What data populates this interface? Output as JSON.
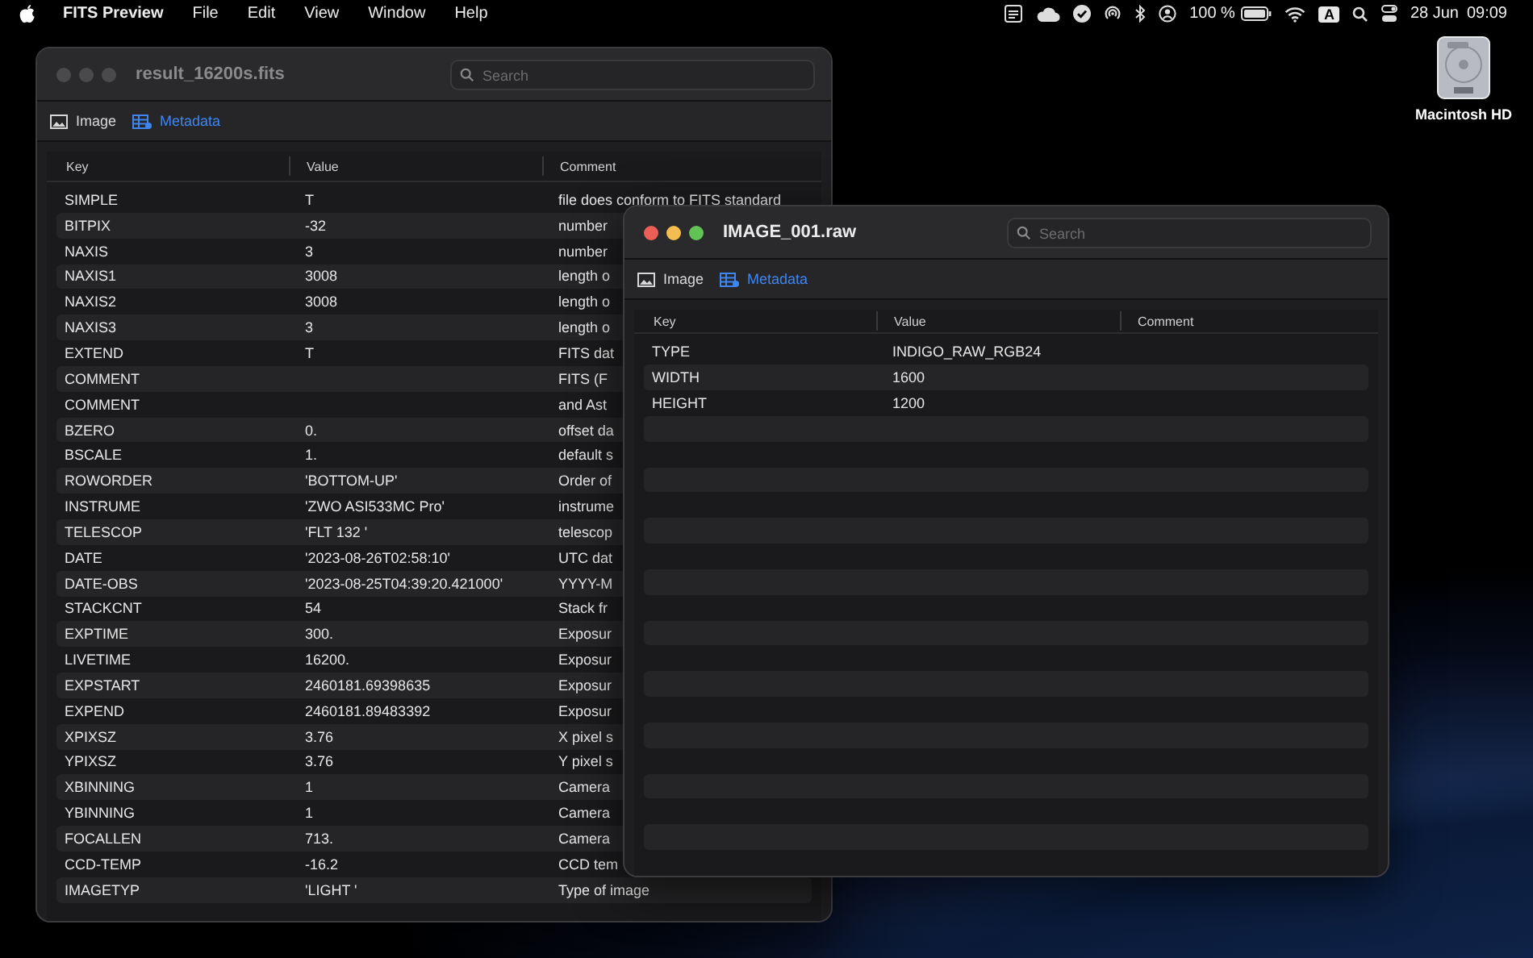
{
  "menu_bar": {
    "app": "FITS Preview",
    "menus": [
      "File",
      "Edit",
      "View",
      "Window",
      "Help"
    ],
    "battery_text": "100 %",
    "input_source": "A",
    "date": "28 Jun",
    "time": "09:09"
  },
  "desktop_icons": [
    {
      "label": "Macintosh HD"
    }
  ],
  "windows": [
    {
      "title": "result_16200s.fits",
      "active": false,
      "search": {
        "placeholder": "Search"
      },
      "tabs": [
        {
          "label": "Image",
          "selected": false
        },
        {
          "label": "Metadata",
          "selected": true
        }
      ],
      "columns": [
        "Key",
        "Value",
        "Comment"
      ],
      "rows": [
        {
          "key": "SIMPLE",
          "value": "T",
          "comment": "file does conform to FITS standard"
        },
        {
          "key": "BITPIX",
          "value": "-32",
          "comment": "number"
        },
        {
          "key": "NAXIS",
          "value": "3",
          "comment": "number"
        },
        {
          "key": "NAXIS1",
          "value": "3008",
          "comment": "length o"
        },
        {
          "key": "NAXIS2",
          "value": "3008",
          "comment": "length o"
        },
        {
          "key": "NAXIS3",
          "value": "3",
          "comment": "length o"
        },
        {
          "key": "EXTEND",
          "value": "T",
          "comment": "FITS dat"
        },
        {
          "key": "COMMENT",
          "comment": "FITS (F"
        },
        {
          "key": "COMMENT",
          "comment": "and Ast"
        },
        {
          "key": "BZERO",
          "value": "0.",
          "comment": "offset da"
        },
        {
          "key": "BSCALE",
          "value": "1.",
          "comment": "default s"
        },
        {
          "key": "ROWORDER",
          "value": "'BOTTOM-UP'",
          "comment": "Order of"
        },
        {
          "key": "INSTRUME",
          "value": "'ZWO ASI533MC Pro'",
          "comment": "instrume"
        },
        {
          "key": "TELESCOP",
          "value": "'FLT 132 '",
          "comment": "telescop"
        },
        {
          "key": "DATE",
          "value": "'2023-08-26T02:58:10'",
          "comment": "UTC dat"
        },
        {
          "key": "DATE-OBS",
          "value": "'2023-08-25T04:39:20.421000'",
          "comment": "YYYY-M"
        },
        {
          "key": "STACKCNT",
          "value": "54",
          "comment": "Stack fr"
        },
        {
          "key": "EXPTIME",
          "value": "300.",
          "comment": "Exposur"
        },
        {
          "key": "LIVETIME",
          "value": "16200.",
          "comment": "Exposur"
        },
        {
          "key": "EXPSTART",
          "value": "2460181.69398635",
          "comment": "Exposur"
        },
        {
          "key": "EXPEND",
          "value": "2460181.89483392",
          "comment": "Exposur"
        },
        {
          "key": "XPIXSZ",
          "value": "3.76",
          "comment": "X pixel s"
        },
        {
          "key": "YPIXSZ",
          "value": "3.76",
          "comment": "Y pixel s"
        },
        {
          "key": "XBINNING",
          "value": "1",
          "comment": "Camera"
        },
        {
          "key": "YBINNING",
          "value": "1",
          "comment": "Camera"
        },
        {
          "key": "FOCALLEN",
          "value": "713.",
          "comment": "Camera"
        },
        {
          "key": "CCD-TEMP",
          "value": "-16.2",
          "comment": "CCD tem"
        },
        {
          "key": "IMAGETYP",
          "value": "'LIGHT   '",
          "comment": "Type of image"
        }
      ]
    },
    {
      "title": "IMAGE_001.raw",
      "active": true,
      "search": {
        "placeholder": "Search"
      },
      "tabs": [
        {
          "label": "Image",
          "selected": false
        },
        {
          "label": "Metadata",
          "selected": true
        }
      ],
      "columns": [
        "Key",
        "Value",
        "Comment"
      ],
      "rows": [
        {
          "key": "TYPE",
          "value": "INDIGO_RAW_RGB24"
        },
        {
          "key": "WIDTH",
          "value": "1600"
        },
        {
          "key": "HEIGHT",
          "value": "1200"
        }
      ]
    }
  ]
}
